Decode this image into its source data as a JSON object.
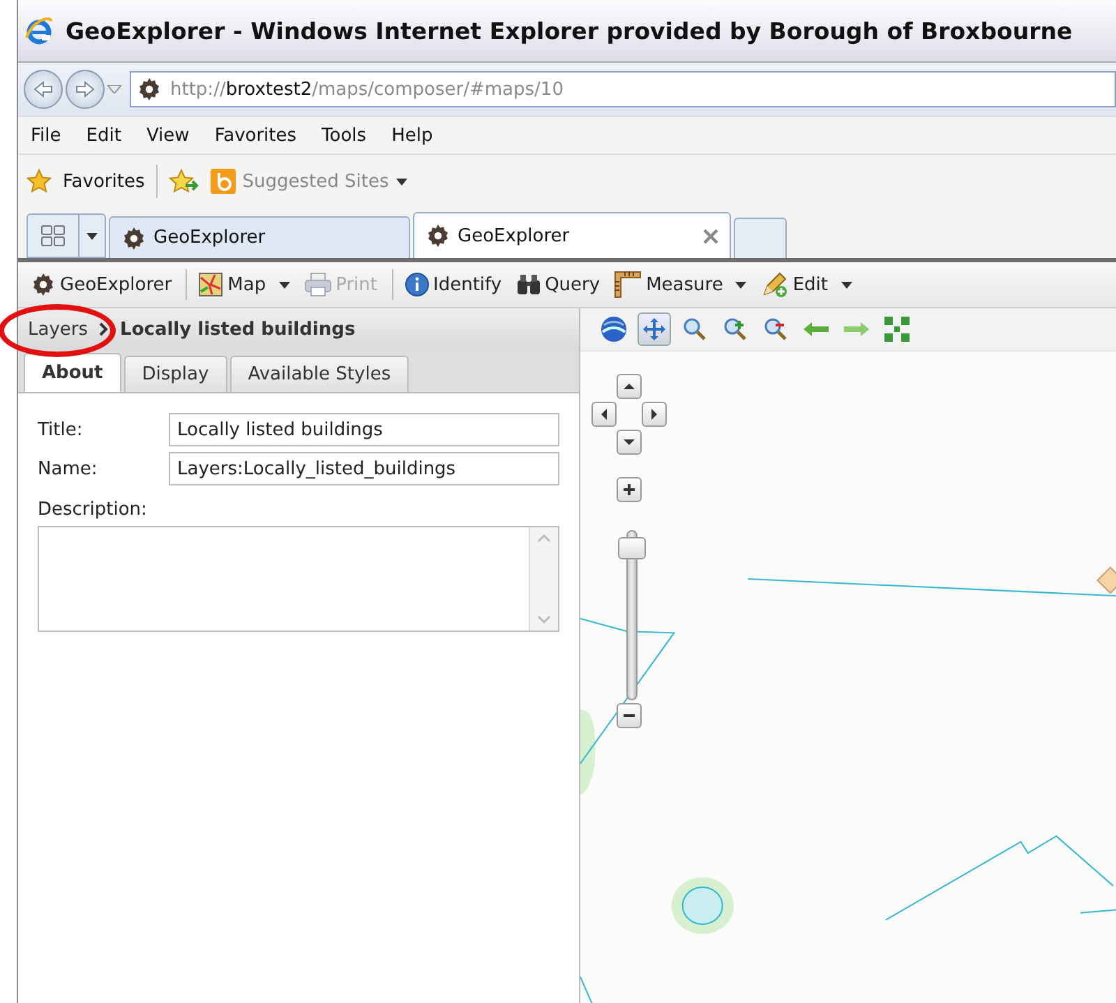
{
  "window": {
    "title": "GeoExplorer - Windows Internet Explorer provided by Borough of Broxbourne"
  },
  "address_bar": {
    "prefix": "http://",
    "host": "broxtest2",
    "path": "/maps/composer/#maps/10"
  },
  "menu": [
    "File",
    "Edit",
    "View",
    "Favorites",
    "Tools",
    "Help"
  ],
  "favorites_bar": {
    "favorites": "Favorites",
    "suggested_sites": "Suggested Sites"
  },
  "browser_tabs": [
    {
      "label": "GeoExplorer",
      "selected": false
    },
    {
      "label": "GeoExplorer",
      "selected": true
    }
  ],
  "toolbar": [
    {
      "label": "GeoExplorer",
      "kind": "gear",
      "separator_before": false,
      "dropdown": false,
      "disabled": false
    },
    {
      "label": "Map",
      "kind": "map",
      "separator_before": true,
      "dropdown": true,
      "disabled": false
    },
    {
      "label": "Print",
      "kind": "printer",
      "separator_before": false,
      "dropdown": false,
      "disabled": true
    },
    {
      "label": "Identify",
      "kind": "info",
      "separator_before": true,
      "dropdown": false,
      "disabled": false
    },
    {
      "label": "Query",
      "kind": "binoculars",
      "separator_before": false,
      "dropdown": false,
      "disabled": false
    },
    {
      "label": "Measure",
      "kind": "ruler",
      "separator_before": false,
      "dropdown": true,
      "disabled": false
    },
    {
      "label": "Edit",
      "kind": "pencil",
      "separator_before": false,
      "dropdown": true,
      "disabled": false
    }
  ],
  "breadcrumb": {
    "root": "Layers",
    "current": "Locally listed buildings"
  },
  "panel_tabs": [
    {
      "label": "About",
      "selected": true
    },
    {
      "label": "Display",
      "selected": false
    },
    {
      "label": "Available Styles",
      "selected": false
    }
  ],
  "form": {
    "title_label": "Title:",
    "title_value": "Locally listed buildings",
    "name_label": "Name:",
    "name_value": "Layers:Locally_listed_buildings",
    "description_label": "Description:"
  },
  "map_tools": [
    {
      "kind": "globe",
      "selected": false
    },
    {
      "kind": "pan",
      "selected": true
    },
    {
      "kind": "magnifier",
      "selected": false
    },
    {
      "kind": "zoom-in",
      "selected": false
    },
    {
      "kind": "zoom-out",
      "selected": false
    },
    {
      "kind": "back",
      "selected": false
    },
    {
      "kind": "forward",
      "selected": false
    },
    {
      "kind": "extent",
      "selected": false
    }
  ],
  "zoom_slider": {
    "level": 0.95
  }
}
